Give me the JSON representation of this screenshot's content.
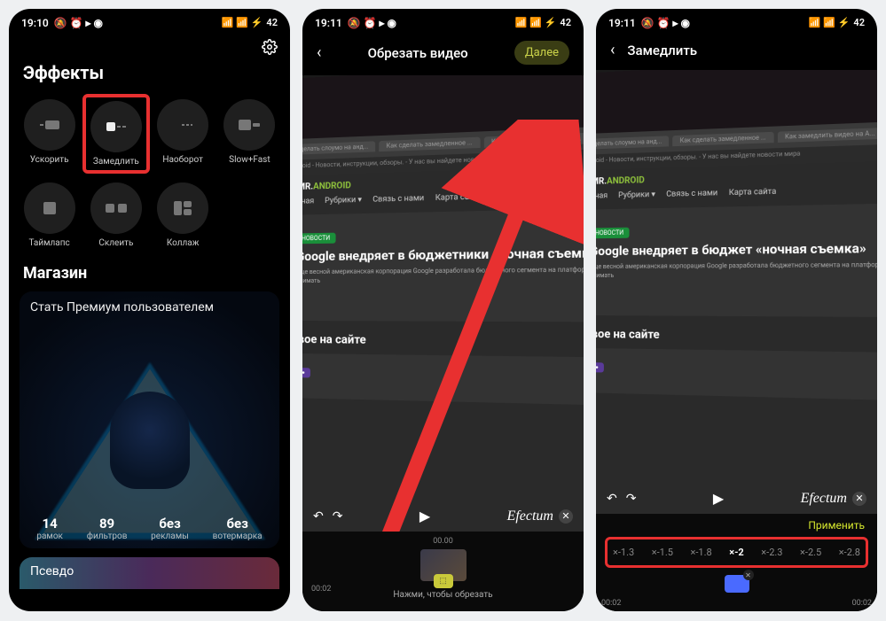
{
  "statusbar": {
    "time1": "19:10",
    "time2": "19:11",
    "time3": "19:11",
    "battery": "42"
  },
  "screen1": {
    "title": "Эффекты",
    "effects": [
      {
        "label": "Ускорить"
      },
      {
        "label": "Замедлить"
      },
      {
        "label": "Наоборот"
      },
      {
        "label": "Slow+Fast"
      },
      {
        "label": "Таймлапс"
      },
      {
        "label": "Склеить"
      },
      {
        "label": "Коллаж"
      }
    ],
    "store_title": "Магазин",
    "premium_label": "Стать Премиум пользователем",
    "stats": [
      {
        "num": "14",
        "txt": "рамок"
      },
      {
        "num": "89",
        "txt": "фильтров"
      },
      {
        "num": "без",
        "txt": "рекламы"
      },
      {
        "num": "без",
        "txt": "вотермарка"
      }
    ],
    "pseudo": "Псевдо"
  },
  "screen2": {
    "title": "Обрезать видео",
    "next": "Далее",
    "brand": "Efectum",
    "trim_top": "00.00",
    "trim_left": "00:02",
    "trim_hint": "Нажми, чтобы обрезать"
  },
  "screen3": {
    "title": "Замедлить",
    "brand": "Efectum",
    "apply": "Применить",
    "speeds": [
      "×-1.3",
      "×-1.5",
      "×-1.8",
      "×-2",
      "×-2.3",
      "×-2.5",
      "×-2.8"
    ],
    "active_speed": "×-2",
    "blue_label": "",
    "tl": "00:02",
    "tr": "00:02"
  },
  "preview": {
    "tabs": [
      "Как сделать слоумо на анд...",
      "Как сделать замедленное ...",
      "Как замедлить видео на А..."
    ],
    "url": "Mr. Android - Новости, инструкции, обзоры. - У нас вы найдете новости мира",
    "logo_pre": "MR.",
    "logo_post": "ANDROID",
    "nav": [
      "Главная",
      "Рубрики ▾",
      "Связь с нами",
      "Карта сайта"
    ],
    "badge": "НОВОСТИ",
    "headline": "Google внедряет в бюджетники «ночная съемка»",
    "headline_short": "Google внедряет в бюджет «ночная съемка»",
    "sub": "Еще весной американская корпорация Google разработала бюджетного сегмента на платформе Android Go могут снимать",
    "section": "Новое на сайте"
  }
}
